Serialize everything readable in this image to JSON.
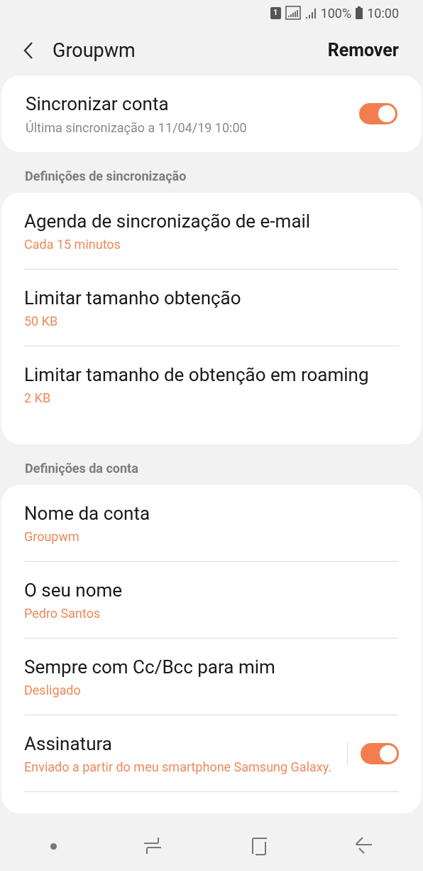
{
  "status_bar": {
    "sim": "1",
    "battery": "100%",
    "time": "10:00"
  },
  "header": {
    "title": "Groupwm",
    "action": "Remover"
  },
  "sync_card": {
    "title": "Sincronizar conta",
    "subtitle": "Última sincronização a 11/04/19  10:00",
    "on": true
  },
  "sections": [
    {
      "title": "Definições de sincronização",
      "items": [
        {
          "kind": "value",
          "title": "Agenda de sincronização de e-mail",
          "value": "Cada 15 minutos"
        },
        {
          "kind": "value",
          "title": "Limitar tamanho obtenção",
          "value": "50 KB"
        },
        {
          "kind": "value",
          "title": "Limitar tamanho de obtenção em roaming",
          "value": "2 KB"
        }
      ]
    },
    {
      "title": "Definições da conta",
      "items": [
        {
          "kind": "value",
          "title": "Nome da conta",
          "value": "Groupwm"
        },
        {
          "kind": "value",
          "title": "O seu nome",
          "value": "Pedro Santos"
        },
        {
          "kind": "value",
          "title": "Sempre com Cc/Bcc para mim",
          "value": "Desligado"
        },
        {
          "kind": "toggle",
          "title": "Assinatura",
          "value": "Enviado a partir do meu smartphone Samsung Galaxy.",
          "on": true
        }
      ]
    }
  ]
}
